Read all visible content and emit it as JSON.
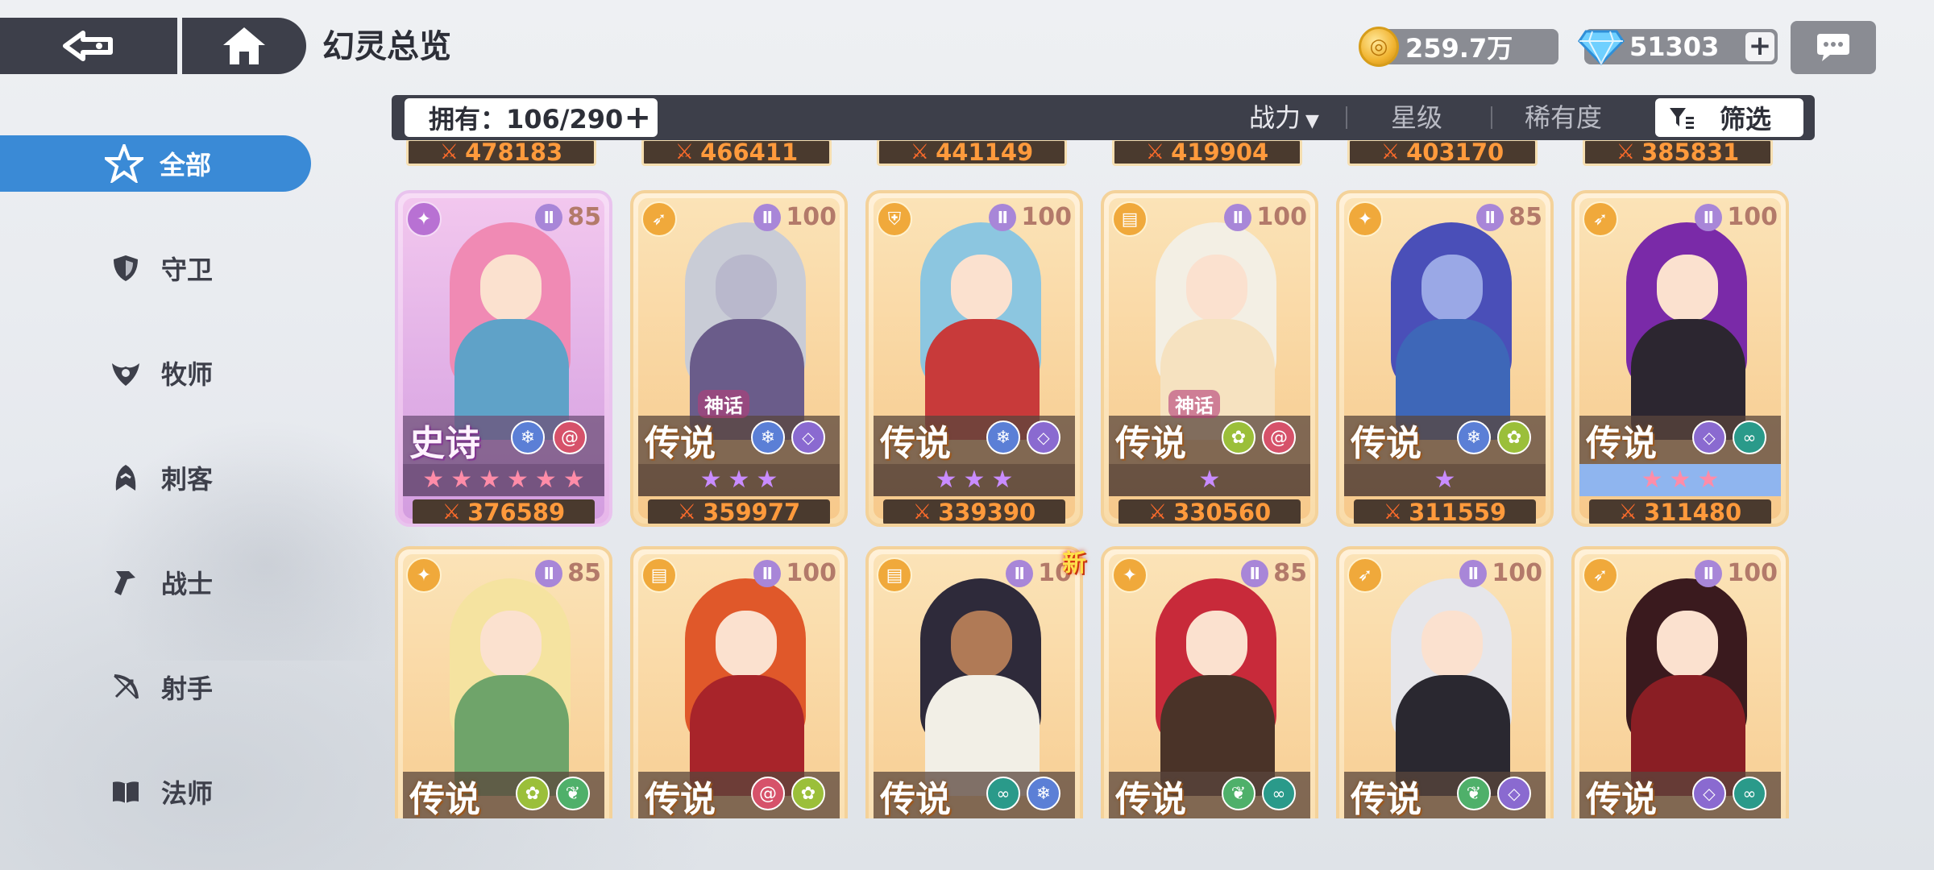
{
  "header": {
    "title": "幻灵总览",
    "gold": "259.7万",
    "gems": "51303"
  },
  "toolbar": {
    "owned": "拥有：106/290",
    "sort_power": "战力",
    "sort_star": "星级",
    "sort_rarity": "稀有度",
    "filter": "筛选"
  },
  "sidebar": {
    "items": [
      {
        "label": "全部",
        "icon": "all-star-icon",
        "active": true
      },
      {
        "label": "守卫",
        "icon": "shield-icon"
      },
      {
        "label": "牧师",
        "icon": "priest-icon"
      },
      {
        "label": "刺客",
        "icon": "assassin-icon"
      },
      {
        "label": "战士",
        "icon": "warrior-icon"
      },
      {
        "label": "射手",
        "icon": "bow-icon"
      },
      {
        "label": "法师",
        "icon": "book-icon"
      }
    ]
  },
  "top_partial_powers": [
    "478183",
    "466411",
    "441149",
    "419904",
    "403170",
    "385831"
  ],
  "row1": [
    {
      "level": "85",
      "rarity": "史诗",
      "tag": "",
      "power": "376589",
      "stars": 6,
      "star_color": "pink",
      "epic": true
    },
    {
      "level": "100",
      "rarity": "传说",
      "tag": "神话",
      "power": "359977",
      "stars": 3,
      "star_color": "purple"
    },
    {
      "level": "100",
      "rarity": "传说",
      "tag": "",
      "power": "339390",
      "stars": 3,
      "star_color": "purple"
    },
    {
      "level": "100",
      "rarity": "传说",
      "tag": "神话",
      "power": "330560",
      "stars": 1,
      "star_color": "purple"
    },
    {
      "level": "85",
      "rarity": "传说",
      "tag": "",
      "power": "311559",
      "stars": 1,
      "star_color": "purple"
    },
    {
      "level": "100",
      "rarity": "传说",
      "tag": "",
      "power": "311480",
      "stars": 3,
      "star_color": "pink",
      "blue_bar": true
    }
  ],
  "row2": [
    {
      "level": "85",
      "rarity": "传说"
    },
    {
      "level": "100",
      "rarity": "传说"
    },
    {
      "level": "10",
      "rarity": "传说",
      "new": "新"
    },
    {
      "level": "85",
      "rarity": "传说"
    },
    {
      "level": "100",
      "rarity": "传说"
    },
    {
      "level": "100",
      "rarity": "传说"
    }
  ],
  "colors": {
    "accent": "#3a8ad6",
    "dark": "#3d3f4a",
    "power_text": "#ff9a3c"
  }
}
